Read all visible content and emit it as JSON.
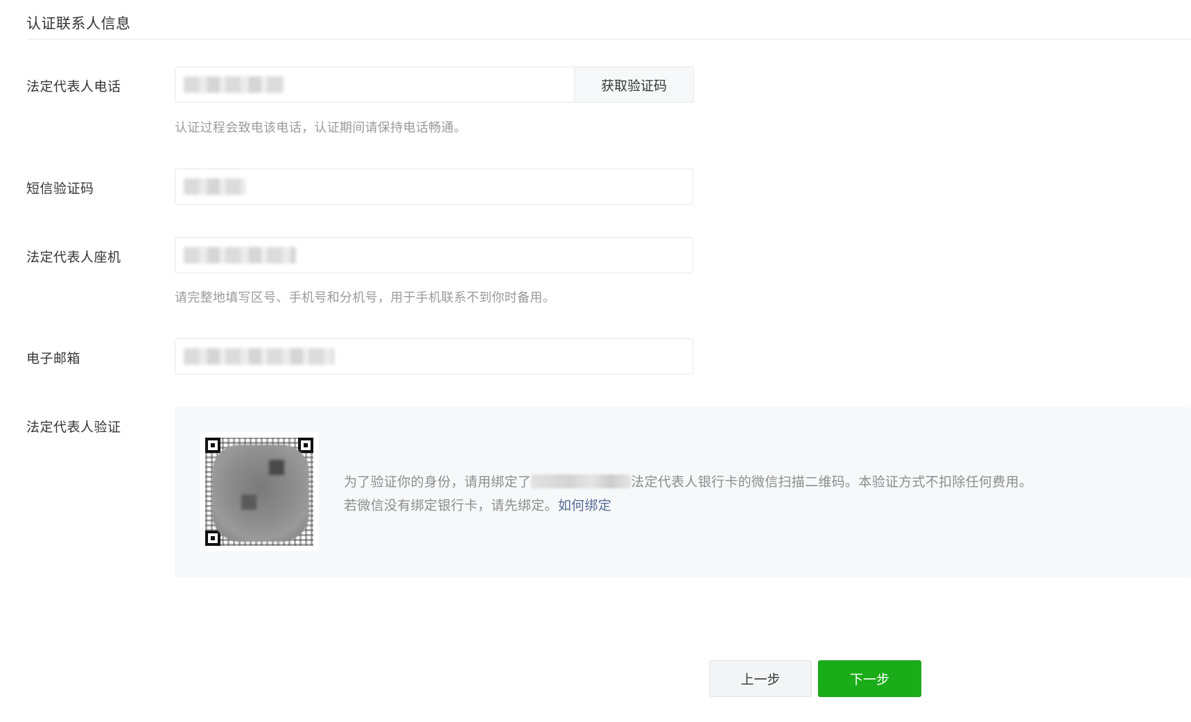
{
  "section": {
    "title": "认证联系人信息"
  },
  "phone": {
    "label": "法定代表人电话",
    "value": "",
    "get_code_button": "获取验证码",
    "tip": "认证过程会致电该电话，认证期间请保持电话畅通。"
  },
  "sms_code": {
    "label": "短信验证码",
    "value": ""
  },
  "landline": {
    "label": "法定代表人座机",
    "value": "",
    "tip": "请完整地填写区号、手机号和分机号，用于手机联系不到你时备用。"
  },
  "email": {
    "label": "电子邮箱",
    "value": ""
  },
  "legal_verify": {
    "label": "法定代表人验证",
    "qr_icon": "qr-code-icon",
    "text_before": "为了验证你的身份，请用绑定了",
    "text_after": "法定代表人银行卡的微信扫描二维码。本验证方式不扣除任何费用。",
    "line2": "若微信没有绑定银行卡，请先绑定。",
    "link_text": "如何绑定",
    "link_color": "#576b95"
  },
  "footer": {
    "prev_label": "上一步",
    "next_label": "下一步",
    "next_color": "#1aad19"
  }
}
